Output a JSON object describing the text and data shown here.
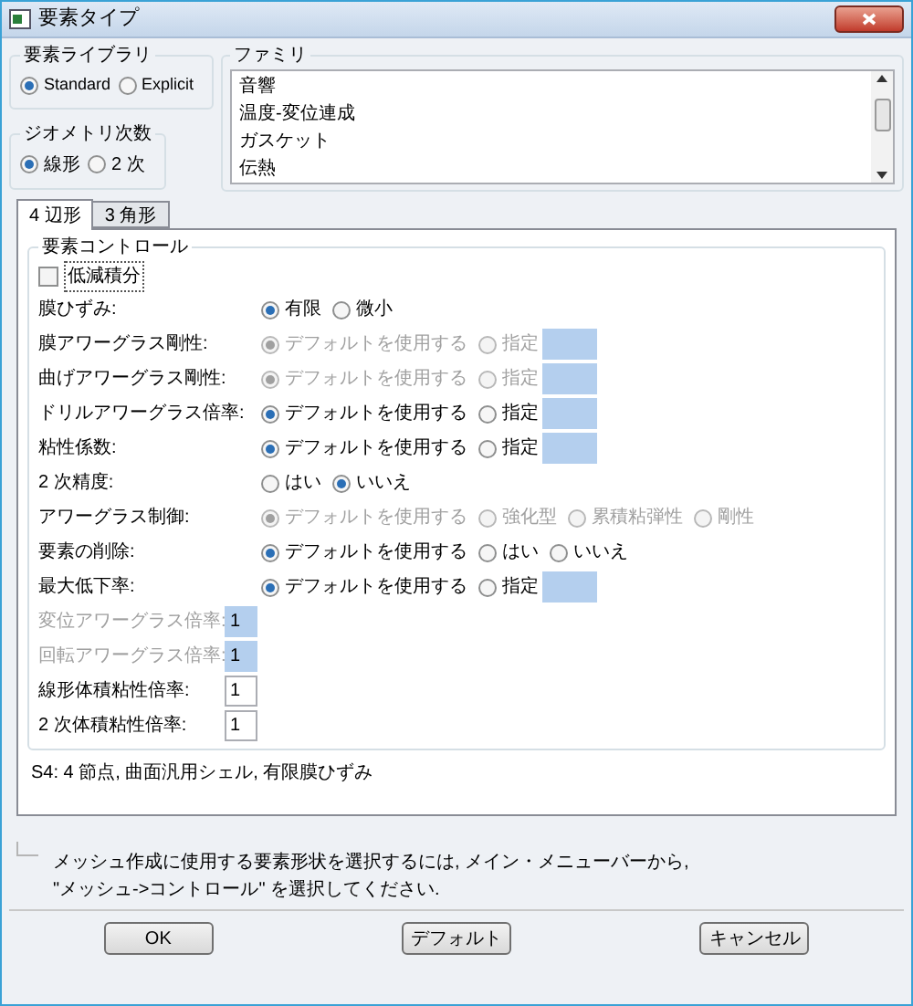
{
  "window": {
    "title": "要素タイプ"
  },
  "element_library": {
    "title": "要素ライブラリ",
    "options": [
      {
        "label": "Standard",
        "selected": true
      },
      {
        "label": "Explicit",
        "selected": false
      }
    ]
  },
  "geometric_order": {
    "title": "ジオメトリ次数",
    "options": [
      {
        "label": "線形",
        "selected": true
      },
      {
        "label": "2 次",
        "selected": false
      }
    ]
  },
  "family": {
    "title": "ファミリ",
    "items": [
      {
        "label": "音響",
        "selected": false
      },
      {
        "label": "温度-変位連成",
        "selected": false
      },
      {
        "label": "ガスケット",
        "selected": false
      },
      {
        "label": "伝熱",
        "selected": false
      }
    ]
  },
  "tabs": [
    {
      "label": "4 辺形",
      "selected": true
    },
    {
      "label": "3 角形",
      "selected": false
    }
  ],
  "element_controls": {
    "title": "要素コントロール",
    "reduced_integration": {
      "label": "低減積分",
      "checked": false
    },
    "rows": [
      {
        "kind": "options",
        "label": "膜ひずみ:",
        "disabled": false,
        "options": [
          {
            "label": "有限",
            "selected": true
          },
          {
            "label": "微小",
            "selected": false
          }
        ]
      },
      {
        "kind": "options",
        "label": "膜アワーグラス剛性:",
        "disabled": true,
        "options": [
          {
            "label": "デフォルトを使用する",
            "selected": true
          },
          {
            "label": "指定",
            "selected": false
          }
        ],
        "field": {
          "disabled": true
        }
      },
      {
        "kind": "options",
        "label": "曲げアワーグラス剛性:",
        "disabled": true,
        "options": [
          {
            "label": "デフォルトを使用する",
            "selected": true
          },
          {
            "label": "指定",
            "selected": false
          }
        ],
        "field": {
          "disabled": true
        }
      },
      {
        "kind": "options",
        "label": "ドリルアワーグラス倍率:",
        "disabled": false,
        "options": [
          {
            "label": "デフォルトを使用する",
            "selected": true
          },
          {
            "label": "指定",
            "selected": false
          }
        ],
        "field": {
          "disabled": true
        }
      },
      {
        "kind": "options",
        "label": "粘性係数:",
        "disabled": false,
        "options": [
          {
            "label": "デフォルトを使用する",
            "selected": true
          },
          {
            "label": "指定",
            "selected": false
          }
        ],
        "field": {
          "disabled": true
        }
      },
      {
        "kind": "options",
        "label": "2 次精度:",
        "disabled": false,
        "options": [
          {
            "label": "はい",
            "selected": false
          },
          {
            "label": "いいえ",
            "selected": true
          }
        ]
      },
      {
        "kind": "options",
        "label": "アワーグラス制御:",
        "disabled": true,
        "options": [
          {
            "label": "デフォルトを使用する",
            "selected": true
          },
          {
            "label": "強化型",
            "selected": false
          },
          {
            "label": "累積粘弾性",
            "selected": false
          },
          {
            "label": "剛性",
            "selected": false
          }
        ]
      },
      {
        "kind": "options",
        "label": "要素の削除:",
        "disabled": false,
        "options": [
          {
            "label": "デフォルトを使用する",
            "selected": true
          },
          {
            "label": "はい",
            "selected": false
          },
          {
            "label": "いいえ",
            "selected": false
          }
        ]
      },
      {
        "kind": "options",
        "label": "最大低下率:",
        "disabled": false,
        "options": [
          {
            "label": "デフォルトを使用する",
            "selected": true
          },
          {
            "label": "指定",
            "selected": false
          }
        ],
        "field": {
          "disabled": true
        }
      },
      {
        "kind": "value",
        "label": "変位アワーグラス倍率:",
        "disabled": true,
        "value": "1"
      },
      {
        "kind": "value",
        "label": "回転アワーグラス倍率:",
        "disabled": true,
        "value": "1"
      },
      {
        "kind": "value",
        "label": "線形体積粘性倍率:",
        "disabled": false,
        "value": "1"
      },
      {
        "kind": "value",
        "label": "2 次体積粘性倍率:",
        "disabled": false,
        "value": "1"
      }
    ]
  },
  "description": "S4:  4 節点, 曲面汎用シェル, 有限膜ひずみ",
  "hint": "メッシュ作成に使用する要素形状を選択するには, メイン・メニューバーから,\n\"メッシュ->コントロール\" を選択してください.",
  "buttons": [
    "OK",
    "デフォルト",
    "キャンセル"
  ]
}
